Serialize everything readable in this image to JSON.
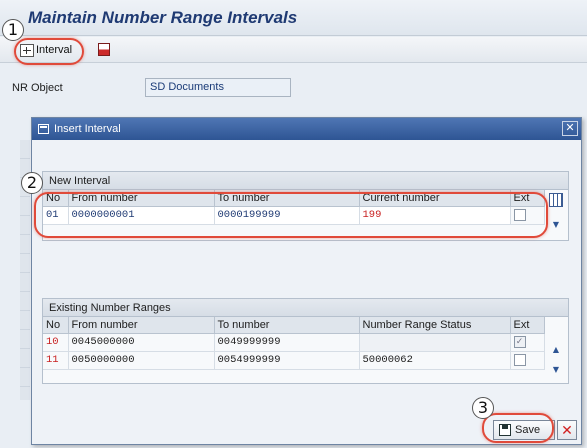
{
  "window": {
    "title": "Maintain Number Range Intervals"
  },
  "toolbar": {
    "interval_label": "Interval",
    "interval_icon": "insert-interval-icon",
    "delete_icon": "delete-interval-icon"
  },
  "nr_object": {
    "label": "NR Object",
    "value": "SD Documents"
  },
  "dialog": {
    "title": "Insert Interval",
    "new_interval": {
      "title": "New Interval",
      "columns": [
        "No",
        "From number",
        "To number",
        "Current number",
        "Ext"
      ],
      "row": {
        "no": "01",
        "from": "0000000001",
        "to": "0000199999",
        "current": "199",
        "ext": false
      }
    },
    "existing": {
      "title": "Existing Number Ranges",
      "columns": [
        "No",
        "From number",
        "To number",
        "Number Range Status",
        "Ext"
      ],
      "rows": [
        {
          "no": "10",
          "from": "0045000000",
          "to": "0049999999",
          "status": "",
          "ext": true
        },
        {
          "no": "11",
          "from": "0050000000",
          "to": "0054999999",
          "status": "50000062",
          "ext": false
        }
      ]
    },
    "save_label": "Save",
    "cancel_symbol": "✕"
  },
  "annotations": {
    "steps": [
      "1",
      "2",
      "3"
    ],
    "color": "#e04a3a"
  }
}
